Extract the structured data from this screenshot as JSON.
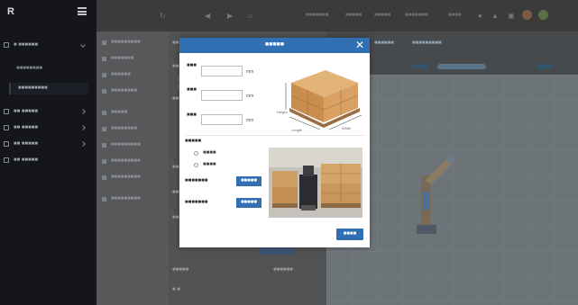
{
  "sidebar": {
    "logo": "R",
    "items": [
      {
        "label": "■ ■■■■■■",
        "expanded": true
      },
      {
        "label": "■■ ■■■■■"
      },
      {
        "label": "■■ ■■■■■"
      },
      {
        "label": "■■ ■■■■■"
      },
      {
        "label": "■■ ■■■■■"
      }
    ],
    "subitems": [
      {
        "label": "■■■■■■■■",
        "active": false
      },
      {
        "label": "■■■■■■■■■",
        "active": true
      }
    ]
  },
  "topbar": {
    "texts": [
      "■■■■■■■",
      "■■■■■",
      "■■■■■",
      "■■■■■■■",
      "■■■■"
    ]
  },
  "menu": {
    "items": [
      "■■■■■■■■■",
      "■■■■■■■",
      "■■■■■■",
      "■■■■■■■■",
      "■■■■■",
      "■■■■■■■■",
      "■■■■■■■■■",
      "■■■■■■■■■",
      "■■■■■■■■■",
      "■■■■■■■■■"
    ]
  },
  "form": {
    "labels": [
      "■■■■",
      "■■■■■",
      "■■■■",
      "■■■■",
      "■■■■■",
      "■■■■■"
    ],
    "bottom_labels": [
      "■■■■■",
      "■■■■■■"
    ]
  },
  "right_panel": {
    "pill_left": "■■■■■■",
    "pill_right": "■■■■■■■■■"
  },
  "modal": {
    "title": "■■■■■",
    "close": "✕",
    "fields": [
      {
        "label": "■■■",
        "unit": "mm"
      },
      {
        "label": "■■■",
        "unit": "mm"
      },
      {
        "label": "■■■",
        "unit": "mm"
      }
    ],
    "dims": {
      "height": "Height",
      "length": "Length",
      "width": "Width"
    },
    "section_label": "■■■■■",
    "radio_options": [
      "■■■■",
      "■■■■"
    ],
    "upload_rows": [
      {
        "label": "■■■■■■■",
        "button": "■■■■■"
      },
      {
        "label": "■■■■■■■",
        "button": "■■■■■"
      }
    ],
    "confirm": "■■■■"
  },
  "colors": {
    "accent": "#2f6fb2",
    "sidebar": "#14161b"
  }
}
